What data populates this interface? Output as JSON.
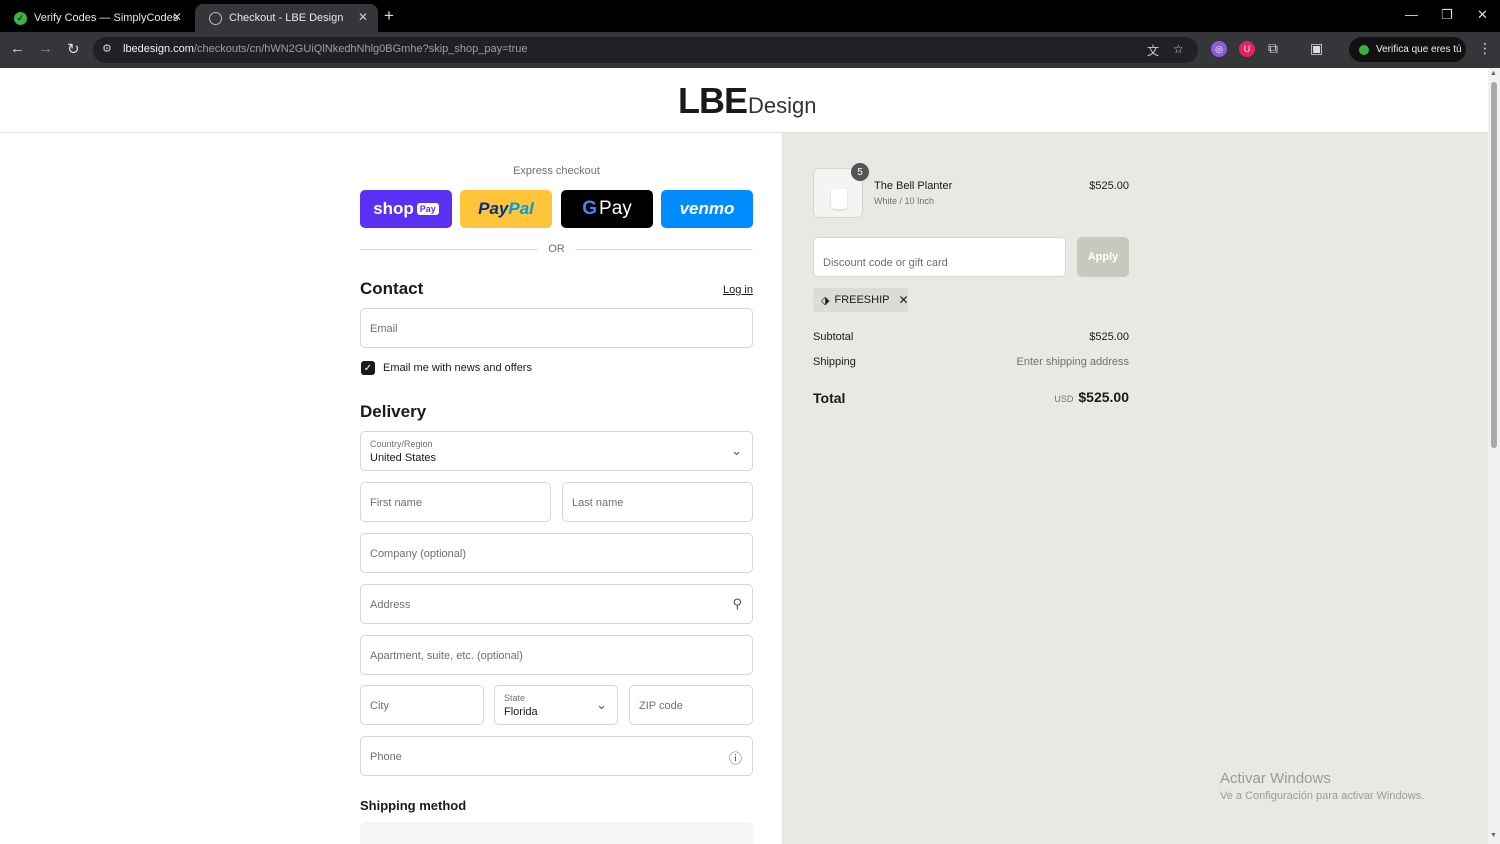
{
  "browser": {
    "tabs": [
      {
        "title": "Verify Codes — SimplyCodes",
        "active": false
      },
      {
        "title": "Checkout - LBE Design",
        "active": true
      }
    ],
    "url_host": "lbedesign.com",
    "url_path": "/checkouts/cn/hWN2GUiQlNkedhNhlg0BGmhe?skip_shop_pay=true",
    "verify_label": "Verifica que eres tú"
  },
  "store": {
    "logo_main": "LBE",
    "logo_sub": "Design"
  },
  "express": {
    "label": "Express checkout",
    "buttons": {
      "shop": "shop",
      "shop_badge": "Pay",
      "paypal_a": "Pay",
      "paypal_b": "Pal",
      "gpay_g": "G",
      "gpay_text": "Pay",
      "venmo": "venmo"
    },
    "or_text": "OR"
  },
  "contact": {
    "title": "Contact",
    "login": "Log in",
    "email_placeholder": "Email",
    "newsletter_label": "Email me with news and offers",
    "newsletter_checked": true
  },
  "delivery": {
    "title": "Delivery",
    "country_label": "Country/Region",
    "country_value": "United States",
    "first_name": "First name",
    "last_name": "Last name",
    "company": "Company (optional)",
    "address": "Address",
    "apartment": "Apartment, suite, etc. (optional)",
    "city": "City",
    "state_label": "State",
    "state_value": "Florida",
    "zip": "ZIP code",
    "phone": "Phone"
  },
  "shipping_method": {
    "title": "Shipping method"
  },
  "order": {
    "item": {
      "name": "The Bell Planter",
      "variant": "White / 10 Inch",
      "price": "$525.00",
      "quantity": "5"
    },
    "discount_placeholder": "Discount code or gift card",
    "apply_label": "Apply",
    "applied_code": "FREESHIP",
    "subtotal_label": "Subtotal",
    "subtotal_value": "$525.00",
    "shipping_label": "Shipping",
    "shipping_value": "Enter shipping address",
    "total_label": "Total",
    "total_currency": "USD",
    "total_value": "$525.00"
  },
  "windows_watermark": {
    "line1": "Activar Windows",
    "line2": "Ve a Configuración para activar Windows."
  },
  "colors": {
    "shop_pay": "#5a31f4",
    "paypal": "#ffc439",
    "venmo": "#008cff",
    "panel_bg": "#e9e9e4",
    "apply_btn": "#c8c8be"
  }
}
